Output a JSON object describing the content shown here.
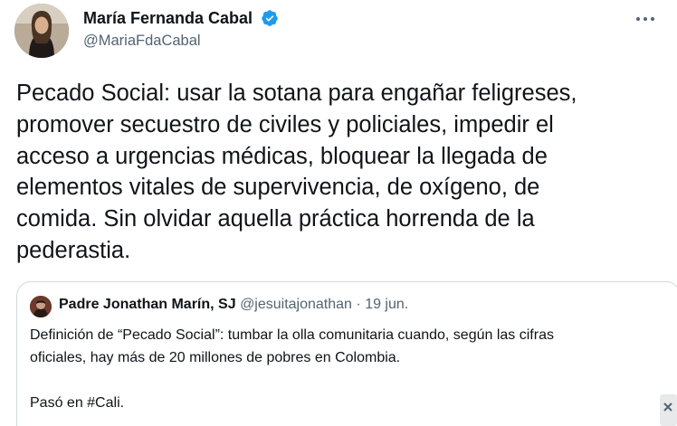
{
  "tweet": {
    "author_name": "María Fernanda Cabal",
    "author_handle": "@MariaFdaCabal",
    "text": "Pecado Social: usar la sotana para engañar feligreses,\npromover secuestro de civiles y policiales, impedir el\nacceso a urgencias médicas, bloquear la llegada de\nelementos vitales de supervivencia, de oxígeno, de\ncomida. Sin olvidar aquella práctica horrenda de la\npederastia.",
    "verified_color": "#1d9bf0"
  },
  "quote": {
    "author_name": "Padre Jonathan Marín, SJ",
    "author_handle": "@jesuitajonathan",
    "separator": "·",
    "date": "19 jun.",
    "text": "Definición de “Pecado Social”: tumbar la olla comunitaria cuando, según las cifras\noficiales, hay más de 20 millones de pobres en Colombia.\n\nPasó en #Cali."
  },
  "icons": {
    "verified": "verified-badge-icon",
    "more": "more-options-icon"
  }
}
